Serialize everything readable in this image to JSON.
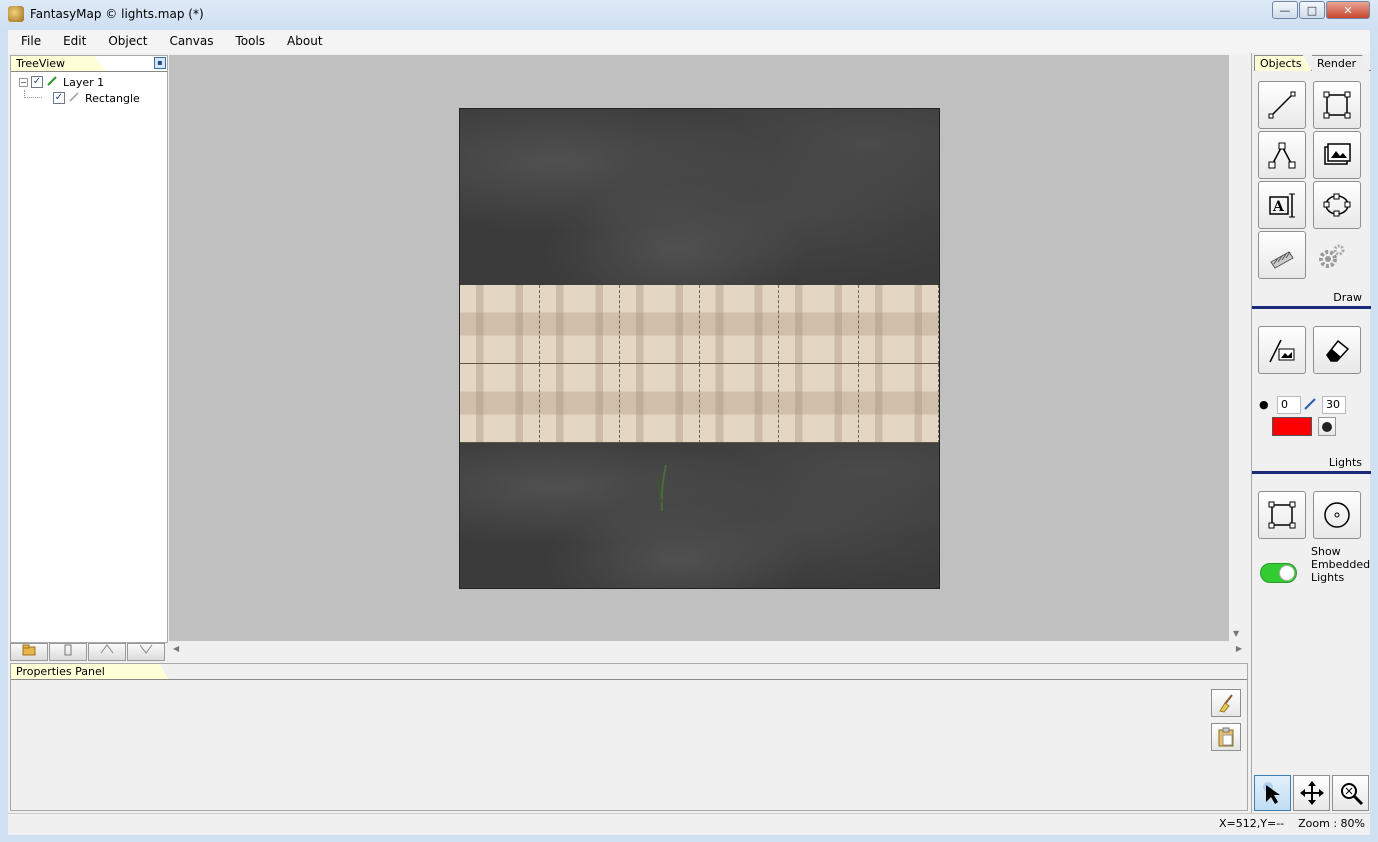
{
  "window": {
    "title": "FantasyMap © lights.map (*)",
    "minimize": "—",
    "maximize": "□",
    "close": "✕"
  },
  "menu": [
    "File",
    "Edit",
    "Object",
    "Canvas",
    "Tools",
    "About"
  ],
  "treeview": {
    "tab_label": "TreeView",
    "pin": "▪",
    "items": [
      {
        "label": "Layer 1",
        "checked": true,
        "expander": "−",
        "check": "✓",
        "icon": "pencil-icon"
      },
      {
        "label": "Rectangle",
        "checked": true,
        "check": "✓",
        "icon": "brush-icon"
      }
    ]
  },
  "right_panel": {
    "tabs": [
      "Objects",
      "Render"
    ],
    "sections": {
      "draw": "Draw",
      "lights": "Lights"
    },
    "stroke_width": "0",
    "brush_size": "30",
    "light_color": "#ff0000",
    "toggle_label": "Show Embedded Lights",
    "toggle_on": true
  },
  "properties": {
    "tab_label": "Properties Panel"
  },
  "status": {
    "coords": "X=512,Y=--",
    "zoom": "Zoom : 80%"
  },
  "colors": {
    "canvas_bg": "#c0c0c0",
    "tab_highlight": "#ffffd8",
    "section_line": "#1c2a7a",
    "toggle_green": "#33cc33"
  }
}
